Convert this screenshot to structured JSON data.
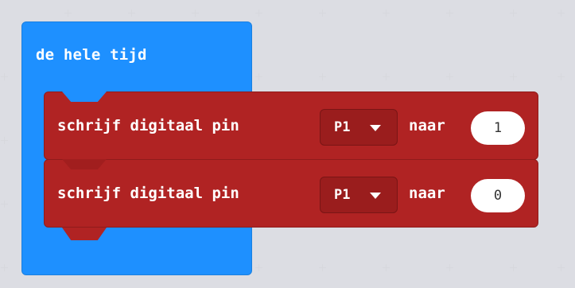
{
  "forever_block": {
    "label": "de hele tijd",
    "color": "#1e90ff"
  },
  "write_blocks": [
    {
      "label": "schrijf digitaal pin",
      "pin": "P1",
      "to_label": "naar",
      "value": "1",
      "color": "#b02323"
    },
    {
      "label": "schrijf digitaal pin",
      "pin": "P1",
      "to_label": "naar",
      "value": "0",
      "color": "#b02323"
    }
  ],
  "icons": {
    "dropdown": "caret-down-icon"
  }
}
